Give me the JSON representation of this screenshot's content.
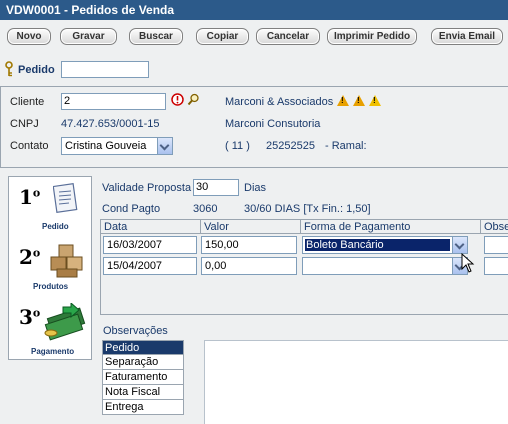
{
  "window": {
    "title": "VDW0001 - Pedidos de Venda"
  },
  "toolbar": {
    "novo": "Novo",
    "gravar": "Gravar",
    "buscar": "Buscar",
    "copiar": "Copiar",
    "cancelar": "Cancelar",
    "imprimir": "Imprimir Pedido",
    "envia": "Envia Email"
  },
  "pedido": {
    "label": "Pedido",
    "value": ""
  },
  "cliente": {
    "label": "Cliente",
    "value": "2",
    "name": "Marconi & Associados",
    "cnpj_label": "CNPJ",
    "cnpj": "47.427.653/0001-15",
    "fantasia": "Marconi Consutoria",
    "contato_label": "Contato",
    "contato": "Cristina Gouveia",
    "ddd": "( 11 )",
    "phone": "25252525",
    "ramal": "- Ramal:"
  },
  "steps": [
    {
      "num": "1",
      "label": "Pedido"
    },
    {
      "num": "2",
      "label": "Produtos"
    },
    {
      "num": "3",
      "label": "Pagamento"
    }
  ],
  "validade": {
    "label": "Validade Proposta",
    "value": "30",
    "unit": "Dias"
  },
  "condpagto": {
    "label": "Cond Pagto",
    "code": "3060",
    "desc": "30/60 DIAS [Tx Fin.: 1,50]"
  },
  "grid": {
    "headers": [
      "Data",
      "Valor",
      "Forma de Pagamento",
      "Obse"
    ],
    "rows": [
      {
        "data": "16/03/2007",
        "valor": "150,00",
        "forma": "Boleto Bancário"
      },
      {
        "data": "15/04/2007",
        "valor": "0,00",
        "forma": ""
      }
    ]
  },
  "observacoes": {
    "label": "Observações",
    "items": [
      "Pedido",
      "Separação",
      "Faturamento",
      "Nota Fiscal",
      "Entrega"
    ],
    "selected": "Pedido"
  },
  "colors": {
    "title_bar": "#2c5a8a",
    "label_blue": "#1a3a6b",
    "selection": "#1a3a6b",
    "warning": "#e8a000"
  },
  "icons": [
    "key-icon",
    "alert-icon",
    "search-icon",
    "warning-icon",
    "document-icon",
    "boxes-icon",
    "money-icon",
    "mouse-cursor-icon"
  ]
}
